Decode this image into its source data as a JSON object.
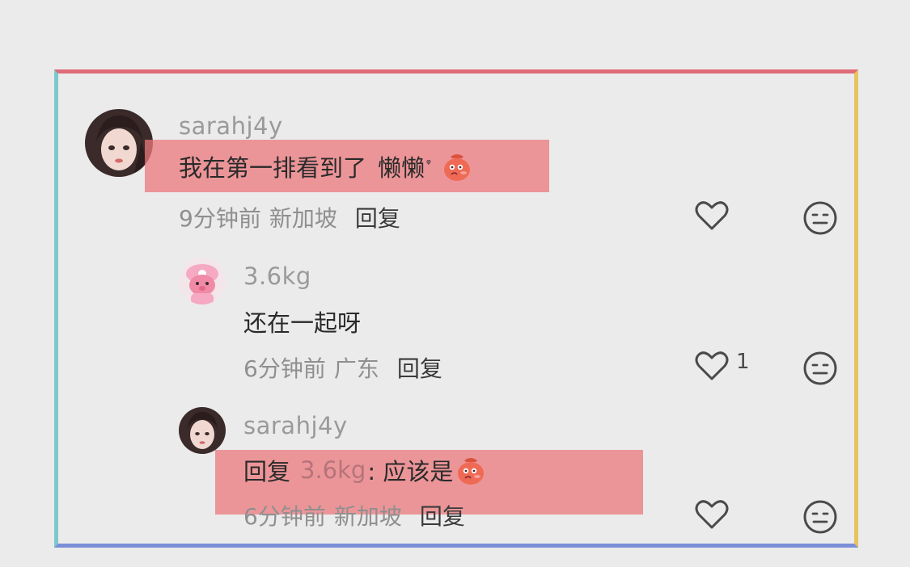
{
  "comments": [
    {
      "username": "sarahj4y",
      "text": "我在第一排看到了",
      "tag": "懒懒",
      "tag_suffix": "ᵠ",
      "time": "9分钟前",
      "location": "新加坡",
      "reply_label": "回复",
      "like_count": ""
    },
    {
      "username": "3.6kg",
      "text": "还在一起呀",
      "time": "6分钟前",
      "location": "广东",
      "reply_label": "回复",
      "like_count": "1"
    },
    {
      "username": "sarahj4y",
      "reply_prefix": "回复",
      "mention": "3.6kg",
      "text": ": 应该是",
      "time": "6分钟前",
      "location": "新加坡",
      "reply_label": "回复",
      "like_count": ""
    }
  ],
  "colors": {
    "highlight": "#ec787c",
    "frame_top": "#e06b78",
    "frame_right": "#e6c45f",
    "frame_bottom": "#7b8fd8",
    "frame_left": "#7cc8cc"
  },
  "icons": {
    "avatar_1": "user-avatar-girl",
    "avatar_2": "user-avatar-pink-bear",
    "emoji": "red-blushing-bag-emoji",
    "like": "heart-outline-icon",
    "dislike": "neutral-face-icon"
  }
}
